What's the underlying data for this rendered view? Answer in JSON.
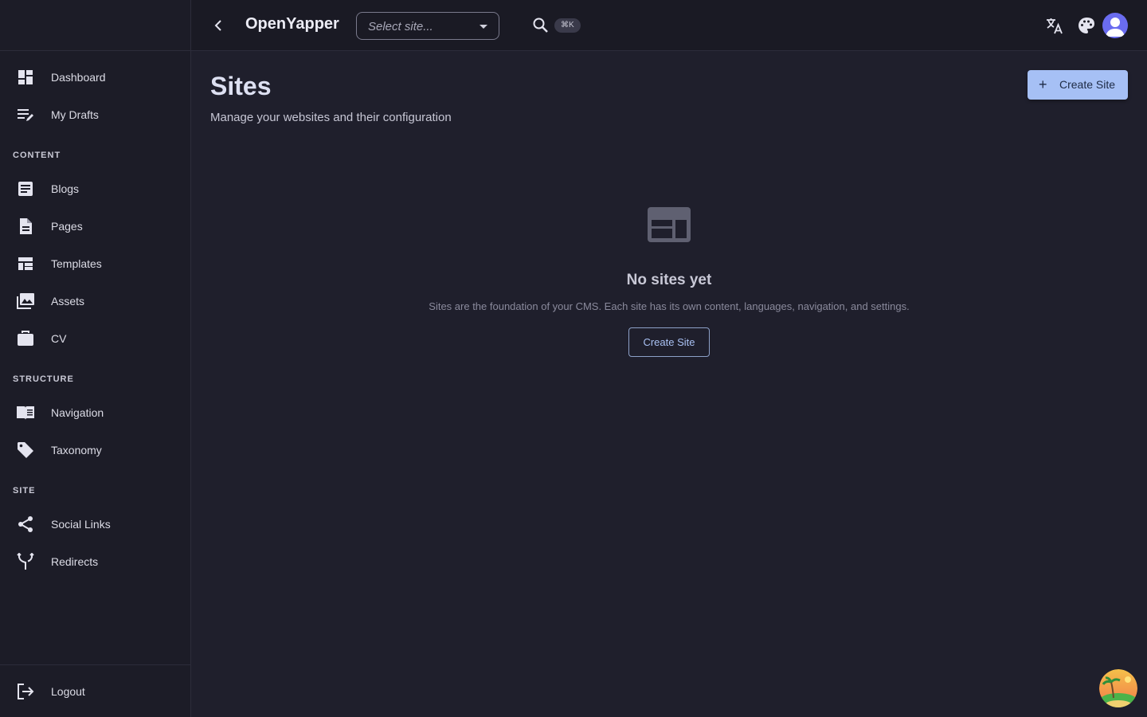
{
  "app": {
    "title": "OpenYapper"
  },
  "header": {
    "site_select_placeholder": "Select site...",
    "search_shortcut": "⌘K"
  },
  "sidebar": {
    "top_items": [
      {
        "label": "Dashboard",
        "icon": "dashboard-icon"
      },
      {
        "label": "My Drafts",
        "icon": "drafts-icon"
      }
    ],
    "sections": [
      {
        "label": "CONTENT",
        "items": [
          {
            "label": "Blogs",
            "icon": "article-icon"
          },
          {
            "label": "Pages",
            "icon": "page-icon"
          },
          {
            "label": "Templates",
            "icon": "template-icon"
          },
          {
            "label": "Assets",
            "icon": "images-icon"
          },
          {
            "label": "CV",
            "icon": "briefcase-icon"
          }
        ]
      },
      {
        "label": "STRUCTURE",
        "items": [
          {
            "label": "Navigation",
            "icon": "book-icon"
          },
          {
            "label": "Taxonomy",
            "icon": "tag-icon"
          }
        ]
      },
      {
        "label": "SITE",
        "items": [
          {
            "label": "Social Links",
            "icon": "share-icon"
          },
          {
            "label": "Redirects",
            "icon": "fork-icon"
          }
        ]
      }
    ],
    "logout_label": "Logout"
  },
  "main": {
    "title": "Sites",
    "subtitle": "Manage your websites and their configuration",
    "create_button_label": "Create Site",
    "empty_state": {
      "title": "No sites yet",
      "description": "Sites are the foundation of your CMS. Each site has its own content, languages, navigation, and settings.",
      "button_label": "Create Site"
    }
  },
  "colors": {
    "background": "#1f1f2c",
    "sidebar": "#1c1c27",
    "accent": "#a6c0f5",
    "avatar": "#6a6cf0"
  }
}
